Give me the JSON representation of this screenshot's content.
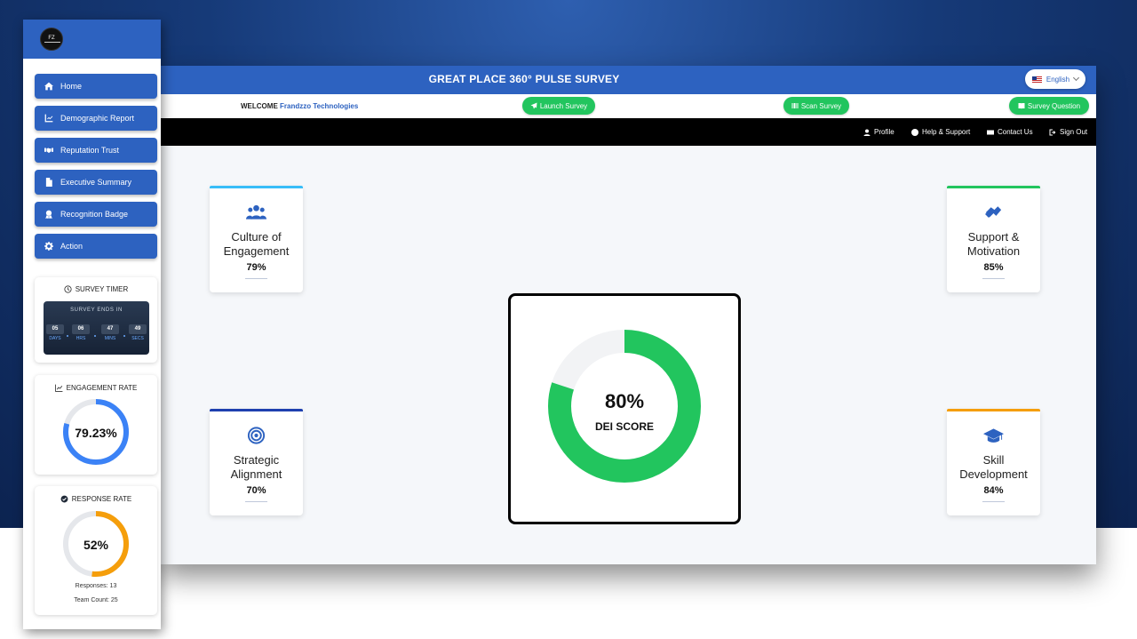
{
  "header": {
    "title": "GREAT PLACE 360° PULSE SURVEY",
    "language": "English"
  },
  "welcome": {
    "prefix": "WELCOME",
    "company": "Frandzzo Technologies"
  },
  "actions": {
    "launch": "Launch Survey",
    "scan": "Scan Survey",
    "question": "Survey Question"
  },
  "nav": {
    "profile": "Profile",
    "help": "Help & Support",
    "contact": "Contact Us",
    "signout": "Sign Out"
  },
  "sidebar": {
    "logo": "FZ",
    "items": [
      {
        "label": "Home",
        "icon": "home-icon"
      },
      {
        "label": "Demographic Report",
        "icon": "chart-icon"
      },
      {
        "label": "Reputation Trust",
        "icon": "handshake-icon"
      },
      {
        "label": "Executive Summary",
        "icon": "document-icon"
      },
      {
        "label": "Recognition Badge",
        "icon": "badge-icon"
      },
      {
        "label": "Action",
        "icon": "gear-icon"
      }
    ]
  },
  "timer": {
    "title": "SURVEY TIMER",
    "caption": "SURVEY ENDS IN",
    "days": "05",
    "days_label": "DAYS",
    "hrs": "06",
    "hrs_label": "HRS",
    "mins": "47",
    "mins_label": "MINS",
    "secs": "49",
    "secs_label": "SECS"
  },
  "engagement": {
    "title": "ENGAGEMENT RATE",
    "value": "79.23%",
    "percent": 79.23,
    "color": "#3b82f6"
  },
  "response": {
    "title": "RESPONSE RATE",
    "value": "52%",
    "percent": 52,
    "color": "#f59e0b",
    "responses": "Responses: 13",
    "team": "Team Count: 25"
  },
  "cards": [
    {
      "title1": "Culture of",
      "title2": "Engagement",
      "value": "79%",
      "icon": "users-icon",
      "accent": "#38bdf8"
    },
    {
      "title1": "Support &",
      "title2": "Motivation",
      "value": "85%",
      "icon": "handshake-icon",
      "accent": "#22c55e"
    },
    {
      "title1": "Strategic",
      "title2": "Alignment",
      "value": "70%",
      "icon": "target-icon",
      "accent": "#1e40af"
    },
    {
      "title1": "Skill",
      "title2": "Development",
      "value": "84%",
      "icon": "graduation-cap-icon",
      "accent": "#f59e0b"
    }
  ],
  "dei": {
    "value": "80%",
    "label": "DEI SCORE",
    "percent": 80,
    "color": "#22c55e"
  }
}
